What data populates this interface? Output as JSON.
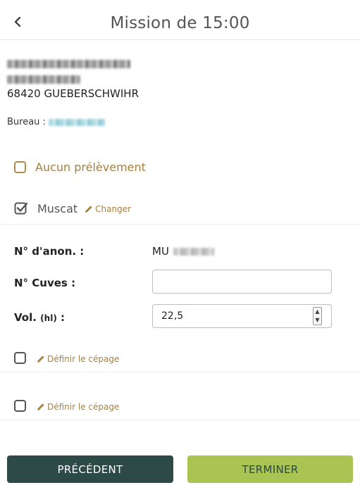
{
  "header": {
    "title": "Mission de 15:00",
    "back_icon": "chevron-left-icon"
  },
  "address": {
    "city_line": "68420 GUEBERSCHWIHR"
  },
  "bureau": {
    "label": "Bureau :"
  },
  "options": {
    "aucun_label": "Aucun prélèvement",
    "muscat_label": "Muscat",
    "change_label": "Changer"
  },
  "form": {
    "anon_label": "N° d'anon. :",
    "anon_prefix": "MU",
    "cuves_label": "N° Cuves :",
    "cuves_value": "",
    "vol_label": "Vol.",
    "vol_unit": "(hl)",
    "vol_colon": ":",
    "vol_value": "22,5"
  },
  "cepage": {
    "row1_link": "Définir le cépage",
    "row2_link": "Définir le cépage"
  },
  "buttons": {
    "previous": "PRÉCÉDENT",
    "finish": "TERMINER"
  },
  "colors": {
    "accent_brown": "#a67f3f",
    "dark_green": "#2d4a46",
    "lime": "#a9c452"
  }
}
